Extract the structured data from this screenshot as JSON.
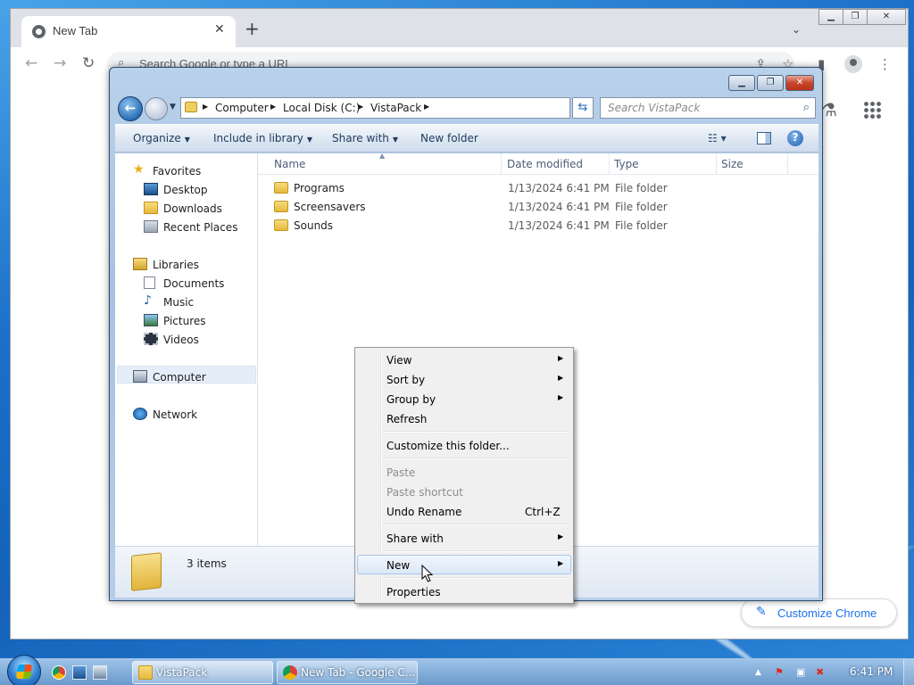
{
  "chrome": {
    "tab_title": "New Tab",
    "omnibox_placeholder": "Search Google or type a URL",
    "customize_label": "Customize Chrome"
  },
  "explorer": {
    "breadcrumbs": [
      "Computer",
      "Local Disk (C:)",
      "VistaPack"
    ],
    "search_placeholder": "Search VistaPack",
    "commands": {
      "organize": "Organize",
      "include_in_library": "Include in library",
      "share_with": "Share with",
      "new_folder": "New folder"
    },
    "nav": {
      "favorites": "Favorites",
      "desktop": "Desktop",
      "downloads": "Downloads",
      "recent_places": "Recent Places",
      "libraries": "Libraries",
      "documents": "Documents",
      "music": "Music",
      "pictures": "Pictures",
      "videos": "Videos",
      "computer": "Computer",
      "network": "Network"
    },
    "columns": {
      "name": "Name",
      "date_modified": "Date modified",
      "type": "Type",
      "size": "Size"
    },
    "files": [
      {
        "name": "Programs",
        "date": "1/13/2024 6:41 PM",
        "type": "File folder"
      },
      {
        "name": "Screensavers",
        "date": "1/13/2024 6:41 PM",
        "type": "File folder"
      },
      {
        "name": "Sounds",
        "date": "1/13/2024 6:41 PM",
        "type": "File folder"
      }
    ],
    "status_count": "3 items"
  },
  "context_menu": {
    "view": "View",
    "sort_by": "Sort by",
    "group_by": "Group by",
    "refresh": "Refresh",
    "customize_folder": "Customize this folder...",
    "paste": "Paste",
    "paste_shortcut": "Paste shortcut",
    "undo_rename": "Undo Rename",
    "undo_shortcut": "Ctrl+Z",
    "share_with": "Share with",
    "new": "New",
    "properties": "Properties"
  },
  "taskbar": {
    "explorer_button": "VistaPack",
    "chrome_button": "New Tab - Google C...",
    "clock": "6:41 PM"
  },
  "colors": {
    "chrome_accent": "#1a73e8",
    "explorer_frame": "#b9d1ea",
    "menu_highlight": "#dbe8f7",
    "desktop_blue": "#1b6fc8"
  }
}
